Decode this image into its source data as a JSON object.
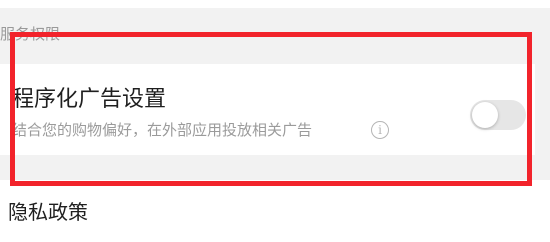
{
  "section": {
    "header": "服务权限"
  },
  "setting": {
    "title": "程序化广告设置",
    "description": "结合您的购物偏好，在外部应用投放相关广告",
    "info_icon_glyph": "i",
    "info_icon": "info-circle-icon",
    "toggle_state": "off"
  },
  "privacy": {
    "label": "隐私政策"
  },
  "colors": {
    "highlight": "#f2232b",
    "toggle_off": "#e6e6e6",
    "section_background": "#f2f2f2"
  }
}
